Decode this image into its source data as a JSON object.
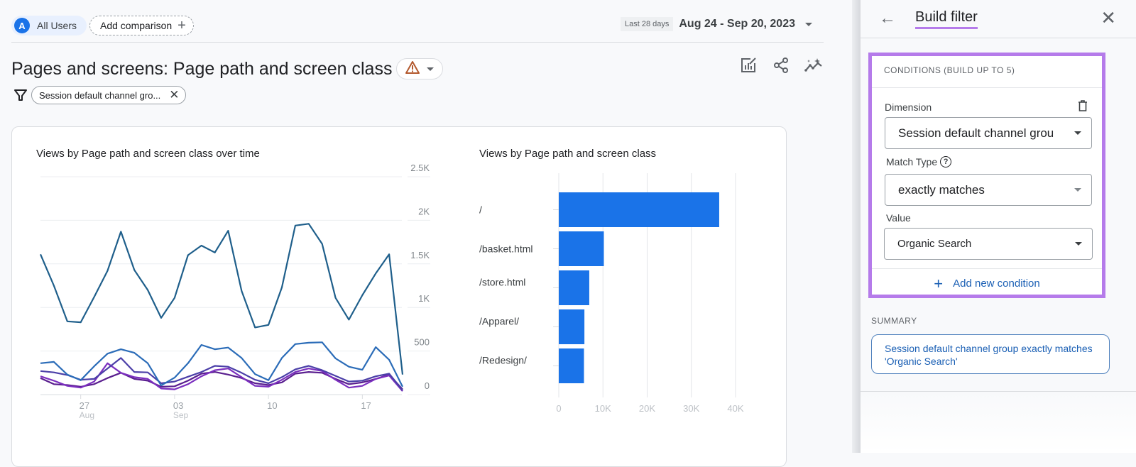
{
  "header": {
    "segment_chip": {
      "avatar_letter": "A",
      "label": "All Users"
    },
    "add_comparison_label": "Add comparison",
    "date_preset": "Last 28 days",
    "date_range": "Aug 24 - Sep 20, 2023"
  },
  "report": {
    "title": "Pages and screens: Page path and screen class",
    "warning_icon": "warning-triangle-icon",
    "toolbar_icons": [
      "customize-report-icon",
      "share-icon",
      "insights-icon"
    ],
    "filter_chip": "Session default channel gro..."
  },
  "colors": {
    "accent_blue": "#1a73e8",
    "highlight_purple": "#b57bea",
    "series_colors": [
      "#1f5f8b",
      "#2b6cb8",
      "#4b3fa8",
      "#7b2fbf",
      "#5a1f8f"
    ]
  },
  "chart_data": [
    {
      "type": "line",
      "title": "Views by Page path and screen class over time",
      "x": [
        "Aug 24",
        "Aug 25",
        "Aug 26",
        "Aug 27",
        "Aug 28",
        "Aug 29",
        "Aug 30",
        "Aug 31",
        "Sep 01",
        "Sep 02",
        "Sep 03",
        "Sep 04",
        "Sep 05",
        "Sep 06",
        "Sep 07",
        "Sep 08",
        "Sep 09",
        "Sep 10",
        "Sep 11",
        "Sep 12",
        "Sep 13",
        "Sep 14",
        "Sep 15",
        "Sep 16",
        "Sep 17",
        "Sep 18",
        "Sep 19",
        "Sep 20"
      ],
      "x_ticks": [
        {
          "day": "27",
          "month": "Aug"
        },
        {
          "day": "03",
          "month": "Sep"
        },
        {
          "day": "10",
          "month": ""
        },
        {
          "day": "17",
          "month": ""
        }
      ],
      "x_tick_index": [
        3,
        10,
        17,
        24
      ],
      "y_ticks": [
        "0",
        "500",
        "1K",
        "1.5K",
        "2K",
        "2.5K"
      ],
      "ylim": [
        0,
        2500
      ],
      "y_axis_side": "right",
      "grid": true,
      "series": [
        {
          "name": "/",
          "values": [
            1610,
            1250,
            840,
            830,
            1120,
            1420,
            1870,
            1430,
            1200,
            880,
            1110,
            1600,
            1710,
            1630,
            1880,
            1190,
            770,
            800,
            1230,
            1940,
            1960,
            1730,
            1110,
            860,
            1140,
            1390,
            1610,
            230
          ]
        },
        {
          "name": "/basket.html",
          "values": [
            360,
            375,
            230,
            165,
            325,
            470,
            520,
            480,
            360,
            105,
            195,
            360,
            570,
            520,
            540,
            420,
            235,
            165,
            420,
            580,
            595,
            600,
            415,
            320,
            285,
            545,
            400,
            90
          ]
        },
        {
          "name": "/store.html",
          "values": [
            270,
            255,
            225,
            170,
            180,
            300,
            420,
            260,
            255,
            130,
            150,
            205,
            260,
            330,
            320,
            250,
            170,
            130,
            200,
            290,
            330,
            280,
            215,
            150,
            160,
            210,
            240,
            50
          ]
        },
        {
          "name": "/Apparel/",
          "values": [
            210,
            160,
            100,
            80,
            150,
            360,
            250,
            200,
            180,
            70,
            60,
            120,
            210,
            280,
            300,
            200,
            100,
            90,
            170,
            260,
            300,
            270,
            170,
            80,
            100,
            180,
            220,
            40
          ]
        },
        {
          "name": "/Redesign/",
          "values": [
            190,
            120,
            110,
            90,
            120,
            190,
            250,
            180,
            160,
            90,
            95,
            160,
            240,
            260,
            230,
            190,
            130,
            110,
            140,
            240,
            260,
            250,
            180,
            120,
            140,
            180,
            230,
            60
          ]
        }
      ]
    },
    {
      "type": "bar",
      "orientation": "horizontal",
      "title": "Views by Page path and screen class",
      "categories": [
        "/",
        "/basket.html",
        "/store.html",
        "/Apparel/",
        "/Redesign/"
      ],
      "values": [
        36300,
        10200,
        6900,
        5800,
        5700
      ],
      "x_ticks": [
        "0",
        "10K",
        "20K",
        "30K",
        "40K"
      ],
      "xlim": [
        0,
        40000
      ],
      "grid": true
    }
  ],
  "panel": {
    "title": "Build filter",
    "conditions_header": "CONDITIONS (BUILD UP TO 5)",
    "dimension_label": "Dimension",
    "dimension_value": "Session default channel grou",
    "match_type_label": "Match Type",
    "match_type_value": "exactly matches",
    "value_label": "Value",
    "value_value": "Organic Search",
    "add_condition_label": "Add new condition",
    "summary_label": "SUMMARY",
    "summary_text": "Session default channel group exactly matches 'Organic Search'"
  }
}
